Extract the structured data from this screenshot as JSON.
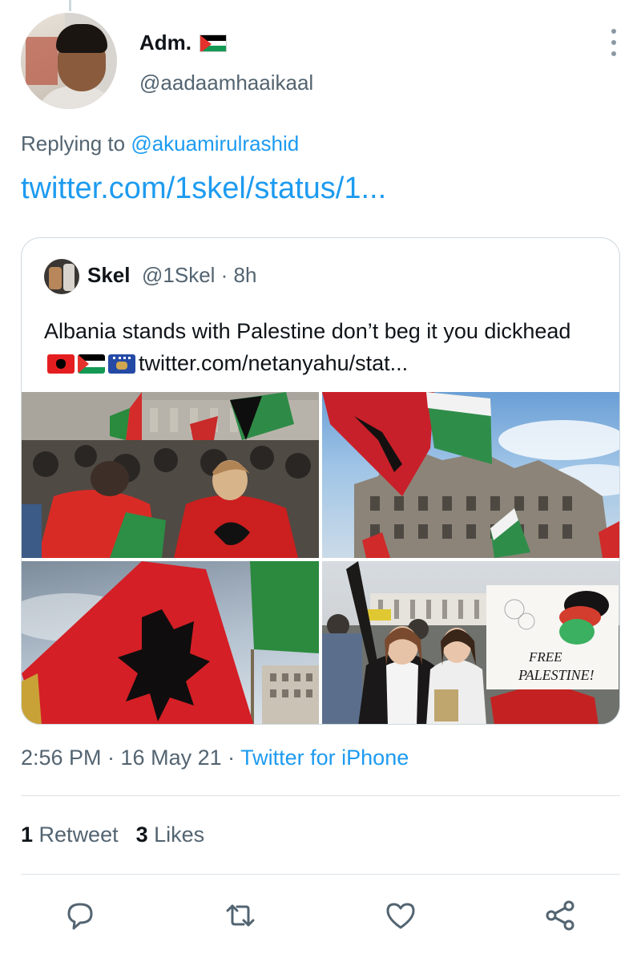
{
  "author": {
    "display_name": "Adm.",
    "handle": "@aadaamhaaikaal",
    "flag_icon": "palestine-flag-icon"
  },
  "reply": {
    "prefix": "Replying to",
    "mention": "@akuamirulrashid"
  },
  "link_text": "twitter.com/1skel/status/1...",
  "quoted_tweet": {
    "name": "Skel",
    "handle": "@1Skel",
    "time": "· 8h",
    "text_before": "Albania stands with Palestine don’t beg it you dickhead",
    "flag_icons": [
      "albania-flag-icon",
      "palestine-flag-icon",
      "kosovo-flag-icon"
    ],
    "link": "twitter.com/netanyahu/stat...",
    "images": [
      {
        "name": "photo-crowd-flags"
      },
      {
        "name": "photo-flag-building"
      },
      {
        "name": "photo-albanian-flag"
      },
      {
        "name": "photo-protesters-free-palestine",
        "sign_text_1": "FREE",
        "sign_text_2": "PALESTINE!"
      }
    ]
  },
  "meta": {
    "time": "2:56 PM · 16 May 21 ·",
    "source": "Twitter for iPhone"
  },
  "stats": {
    "retweet_count": "1",
    "retweet_label": "Retweet",
    "like_count": "3",
    "like_label": "Likes"
  },
  "actions": [
    "reply-icon",
    "retweet-icon",
    "like-icon",
    "share-icon"
  ],
  "colors": {
    "accent": "#1d9bf0",
    "secondary_text": "#536471",
    "primary_text": "#0f1419",
    "border": "#cfd9de"
  }
}
